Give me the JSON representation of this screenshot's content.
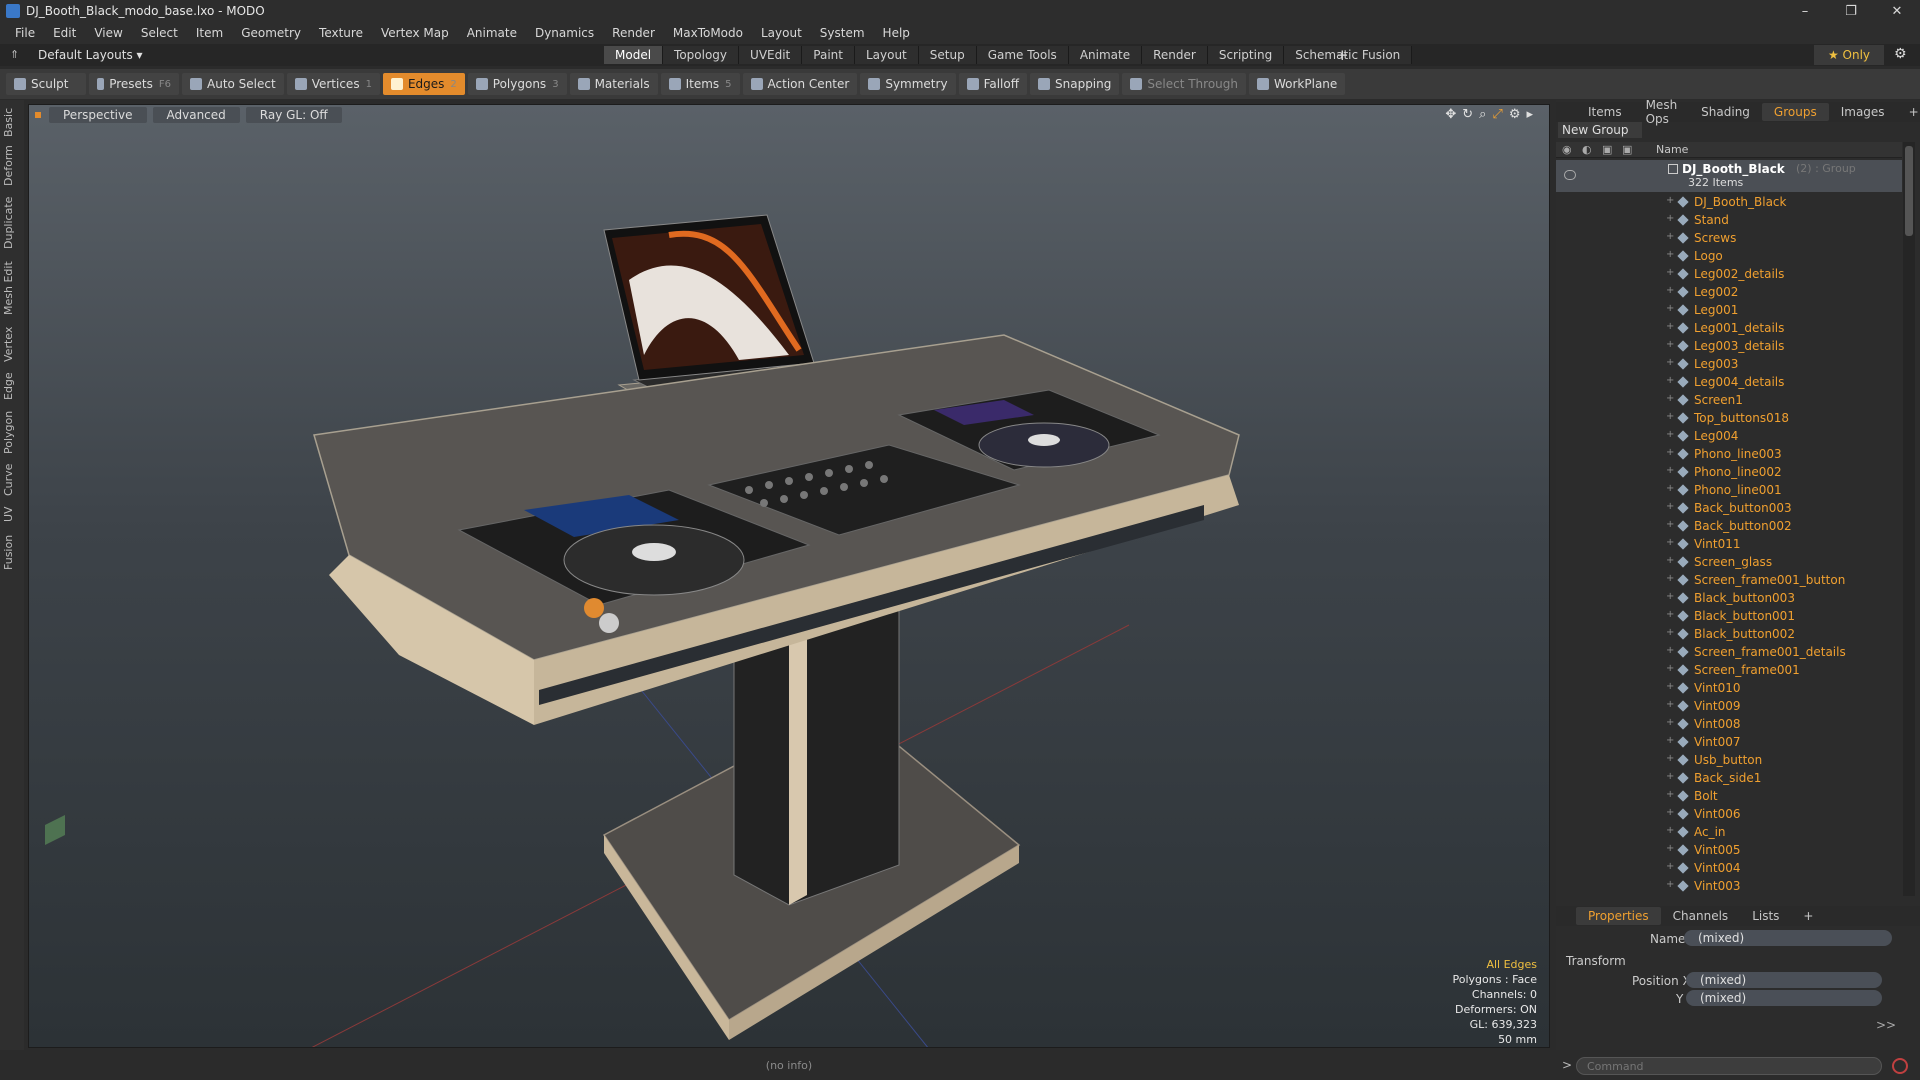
{
  "window": {
    "title": "DJ_Booth_Black_modo_base.lxo - MODO",
    "controls": [
      "–",
      "❐",
      "✕"
    ]
  },
  "menu": [
    "File",
    "Edit",
    "View",
    "Select",
    "Item",
    "Geometry",
    "Texture",
    "Vertex Map",
    "Animate",
    "Dynamics",
    "Render",
    "MaxToModo",
    "Layout",
    "System",
    "Help"
  ],
  "layoutbar": {
    "layout_dropdown": "Default Layouts ▾",
    "tabs": [
      "Model",
      "Topology",
      "UVEdit",
      "Paint",
      "Layout",
      "Setup",
      "Game Tools",
      "Animate",
      "Render",
      "Scripting",
      "Schematic Fusion"
    ],
    "active_tab": "Model",
    "only_label": "★ Only"
  },
  "toolbar": {
    "sculpt": "Sculpt",
    "presets": "Presets",
    "presets_key": "F6",
    "auto_select": "Auto Select",
    "vertices": "Vertices",
    "vertices_key": "1",
    "edges": "Edges",
    "edges_key": "2",
    "polygons": "Polygons",
    "polygons_key": "3",
    "materials": "Materials",
    "items": "Items",
    "items_key": "5",
    "action_center": "Action Center",
    "symmetry": "Symmetry",
    "falloff": "Falloff",
    "snapping": "Snapping",
    "select_through": "Select Through",
    "workplane": "WorkPlane"
  },
  "left_tabs": [
    "Basic",
    "Deform",
    "Duplicate",
    "Mesh Edit",
    "Vertex",
    "Edge",
    "Polygon",
    "Curve",
    "UV",
    "Fusion"
  ],
  "viewport": {
    "view_mode": "Perspective",
    "shading": "Advanced",
    "raygl": "Ray GL: Off",
    "info": {
      "mode": "All Edges",
      "polygons": "Polygons : Face",
      "channels": "Channels: 0",
      "deformers": "Deformers: ON",
      "gl": "GL: 639,323",
      "scale": "50 mm"
    }
  },
  "status": {
    "text": "(no info)"
  },
  "right_panel": {
    "tabs": [
      "Items",
      "Mesh Ops",
      "Shading",
      "Groups",
      "Images"
    ],
    "active_tab": "Groups",
    "new_group": "New Group",
    "column_name": "Name",
    "group": {
      "name": "DJ_Booth_Black",
      "type": "(2) : Group",
      "count": "322 Items"
    },
    "items": [
      "DJ_Booth_Black",
      "Stand",
      "Screws",
      "Logo",
      "Leg002_details",
      "Leg002",
      "Leg001",
      "Leg001_details",
      "Leg003_details",
      "Leg003",
      "Leg004_details",
      "Screen1",
      "Top_buttons018",
      "Leg004",
      "Phono_line003",
      "Phono_line002",
      "Phono_line001",
      "Back_button003",
      "Back_button002",
      "Vint011",
      "Screen_glass",
      "Screen_frame001_button",
      "Black_button003",
      "Black_button001",
      "Black_button002",
      "Screen_frame001_details",
      "Screen_frame001",
      "Vint010",
      "Vint009",
      "Vint008",
      "Vint007",
      "Usb_button",
      "Back_side1",
      "Bolt",
      "Vint006",
      "Ac_in",
      "Vint005",
      "Vint004",
      "Vint003"
    ]
  },
  "properties": {
    "tabs": [
      "Properties",
      "Channels",
      "Lists"
    ],
    "active_tab": "Properties",
    "name_label": "Name",
    "name_value": "(mixed)",
    "transform_label": "Transform",
    "position_x_label": "Position X",
    "position_x": "(mixed)",
    "y_label": "Y",
    "position_y": "(mixed)",
    "more": ">>"
  },
  "command": {
    "placeholder": "Command",
    "prompt": ">"
  }
}
